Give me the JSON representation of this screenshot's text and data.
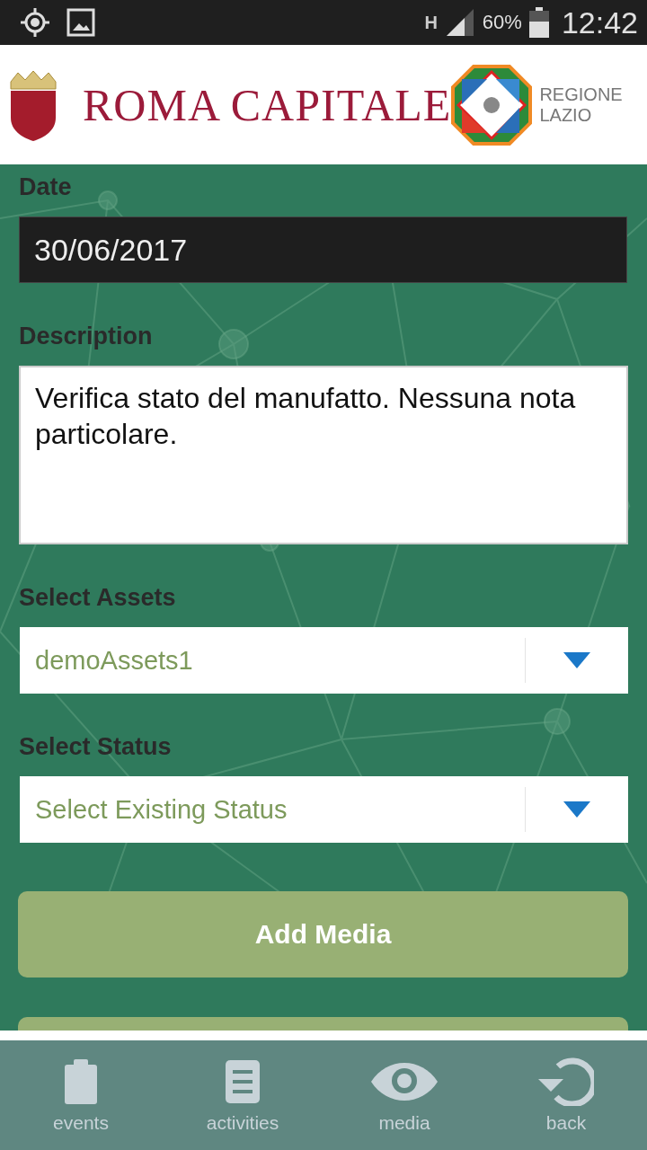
{
  "status_bar": {
    "network": "H",
    "battery": "60%",
    "time": "12:42"
  },
  "header": {
    "title": "ROMA CAPITALE",
    "region": [
      "REGIONE",
      "LAZIO"
    ]
  },
  "fields": [
    {
      "kind": "date",
      "label": "Date",
      "value": "30/06/2017"
    },
    {
      "kind": "textarea",
      "label": "Description",
      "value": "Verifica stato del manufatto. Nessuna nota particolare."
    },
    {
      "kind": "select",
      "label": "Select Assets",
      "value": "demoAssets1"
    },
    {
      "kind": "select",
      "label": "Select Status",
      "placeholder": "Select Existing Status"
    }
  ],
  "buttons": [
    {
      "kind": "button",
      "label": "Add Media"
    },
    {
      "kind": "button"
    }
  ],
  "nav": [
    {
      "label": "events"
    },
    {
      "label": "activities"
    },
    {
      "label": "media"
    },
    {
      "label": "back"
    }
  ]
}
